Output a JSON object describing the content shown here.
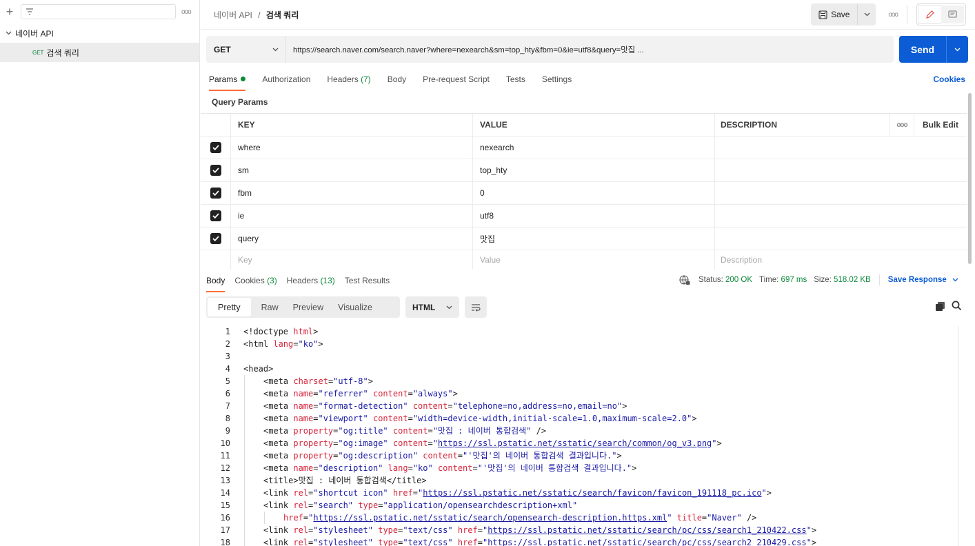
{
  "sidebar": {
    "collection": "네이버 API",
    "request": {
      "method": "GET",
      "name": "검색 쿼리"
    }
  },
  "header": {
    "breadcrumb_parent": "네이버 API",
    "breadcrumb_sep": "/",
    "breadcrumb_current": "검색 쿼리",
    "save_label": "Save"
  },
  "request": {
    "method": "GET",
    "url": "https://search.naver.com/search.naver?where=nexearch&sm=top_hty&fbm=0&ie=utf8&query=맛집 ...",
    "send_label": "Send"
  },
  "req_tabs": [
    {
      "label": "Params"
    },
    {
      "label": "Authorization"
    },
    {
      "label": "Headers",
      "count": "(7)"
    },
    {
      "label": "Body"
    },
    {
      "label": "Pre-request Script"
    },
    {
      "label": "Tests"
    },
    {
      "label": "Settings"
    }
  ],
  "cookies_link": "Cookies",
  "query_params_title": "Query Params",
  "table": {
    "headers": {
      "key": "KEY",
      "value": "VALUE",
      "description": "DESCRIPTION",
      "bulk_edit": "Bulk Edit"
    },
    "rows": [
      {
        "key": "where",
        "value": "nexearch"
      },
      {
        "key": "sm",
        "value": "top_hty"
      },
      {
        "key": "fbm",
        "value": "0"
      },
      {
        "key": "ie",
        "value": "utf8"
      },
      {
        "key": "query",
        "value": "맛집"
      }
    ],
    "placeholders": {
      "key": "Key",
      "value": "Value",
      "description": "Description"
    }
  },
  "resp_tabs": [
    {
      "label": "Body"
    },
    {
      "label": "Cookies",
      "count": "(3)"
    },
    {
      "label": "Headers",
      "count": "(13)"
    },
    {
      "label": "Test Results"
    }
  ],
  "status": {
    "status_label": "Status:",
    "status_value": "200 OK",
    "time_label": "Time:",
    "time_value": "697 ms",
    "size_label": "Size:",
    "size_value": "518.02 KB",
    "save_response": "Save Response"
  },
  "view_modes": [
    "Pretty",
    "Raw",
    "Preview",
    "Visualize"
  ],
  "format": "HTML",
  "code_lines": [
    {
      "n": "1",
      "indent": 0,
      "parts": [
        [
          "tg",
          "<!doctype "
        ],
        [
          "at",
          "html"
        ],
        [
          "tg",
          ">"
        ]
      ]
    },
    {
      "n": "2",
      "indent": 0,
      "parts": [
        [
          "tg",
          "<html "
        ],
        [
          "at",
          "lang"
        ],
        [
          "tg",
          "="
        ],
        [
          "st",
          "\"ko\""
        ],
        [
          "tg",
          ">"
        ]
      ]
    },
    {
      "n": "3",
      "indent": 0,
      "parts": []
    },
    {
      "n": "4",
      "indent": 0,
      "parts": [
        [
          "tg",
          "<head>"
        ]
      ]
    },
    {
      "n": "5",
      "indent": 1,
      "parts": [
        [
          "tg",
          "<meta "
        ],
        [
          "at",
          "charset"
        ],
        [
          "tg",
          "="
        ],
        [
          "st",
          "\"utf-8\""
        ],
        [
          "tg",
          ">"
        ]
      ]
    },
    {
      "n": "6",
      "indent": 1,
      "parts": [
        [
          "tg",
          "<meta "
        ],
        [
          "at",
          "name"
        ],
        [
          "tg",
          "="
        ],
        [
          "st",
          "\"referrer\""
        ],
        [
          "tg",
          " "
        ],
        [
          "at",
          "content"
        ],
        [
          "tg",
          "="
        ],
        [
          "st",
          "\"always\""
        ],
        [
          "tg",
          ">"
        ]
      ]
    },
    {
      "n": "7",
      "indent": 1,
      "parts": [
        [
          "tg",
          "<meta "
        ],
        [
          "at",
          "name"
        ],
        [
          "tg",
          "="
        ],
        [
          "st",
          "\"format-detection\""
        ],
        [
          "tg",
          " "
        ],
        [
          "at",
          "content"
        ],
        [
          "tg",
          "="
        ],
        [
          "st",
          "\"telephone=no,address=no,email=no\""
        ],
        [
          "tg",
          ">"
        ]
      ]
    },
    {
      "n": "8",
      "indent": 1,
      "parts": [
        [
          "tg",
          "<meta "
        ],
        [
          "at",
          "name"
        ],
        [
          "tg",
          "="
        ],
        [
          "st",
          "\"viewport\""
        ],
        [
          "tg",
          " "
        ],
        [
          "at",
          "content"
        ],
        [
          "tg",
          "="
        ],
        [
          "st",
          "\"width=device-width,initial-scale=1.0,maximum-scale=2.0\""
        ],
        [
          "tg",
          ">"
        ]
      ]
    },
    {
      "n": "9",
      "indent": 1,
      "parts": [
        [
          "tg",
          "<meta "
        ],
        [
          "at",
          "property"
        ],
        [
          "tg",
          "="
        ],
        [
          "st",
          "\"og:title\""
        ],
        [
          "tg",
          " "
        ],
        [
          "at",
          "content"
        ],
        [
          "tg",
          "="
        ],
        [
          "st",
          "\"맛집 : 네이버 통합검색\""
        ],
        [
          "tg",
          " />"
        ]
      ]
    },
    {
      "n": "10",
      "indent": 1,
      "parts": [
        [
          "tg",
          "<meta "
        ],
        [
          "at",
          "property"
        ],
        [
          "tg",
          "="
        ],
        [
          "st",
          "\"og:image\""
        ],
        [
          "tg",
          " "
        ],
        [
          "at",
          "content"
        ],
        [
          "tg",
          "="
        ],
        [
          "st",
          "\""
        ],
        [
          "lk",
          "https://ssl.pstatic.net/sstatic/search/common/og_v3.png"
        ],
        [
          "st",
          "\""
        ],
        [
          "tg",
          ">"
        ]
      ]
    },
    {
      "n": "11",
      "indent": 1,
      "parts": [
        [
          "tg",
          "<meta "
        ],
        [
          "at",
          "property"
        ],
        [
          "tg",
          "="
        ],
        [
          "st",
          "\"og:description\""
        ],
        [
          "tg",
          " "
        ],
        [
          "at",
          "content"
        ],
        [
          "tg",
          "="
        ],
        [
          "st",
          "\"'맛집'의 네이버 통합검색 결과입니다.\""
        ],
        [
          "tg",
          ">"
        ]
      ]
    },
    {
      "n": "12",
      "indent": 1,
      "parts": [
        [
          "tg",
          "<meta "
        ],
        [
          "at",
          "name"
        ],
        [
          "tg",
          "="
        ],
        [
          "st",
          "\"description\""
        ],
        [
          "tg",
          " "
        ],
        [
          "at",
          "lang"
        ],
        [
          "tg",
          "="
        ],
        [
          "st",
          "\"ko\""
        ],
        [
          "tg",
          " "
        ],
        [
          "at",
          "content"
        ],
        [
          "tg",
          "="
        ],
        [
          "st",
          "\"'맛집'의 네이버 통합검색 결과입니다.\""
        ],
        [
          "tg",
          ">"
        ]
      ]
    },
    {
      "n": "13",
      "indent": 1,
      "parts": [
        [
          "tg",
          "<title>맛집 : 네이버 통합검색</title>"
        ]
      ]
    },
    {
      "n": "14",
      "indent": 1,
      "parts": [
        [
          "tg",
          "<link "
        ],
        [
          "at",
          "rel"
        ],
        [
          "tg",
          "="
        ],
        [
          "st",
          "\"shortcut icon\""
        ],
        [
          "tg",
          " "
        ],
        [
          "at",
          "href"
        ],
        [
          "tg",
          "="
        ],
        [
          "st",
          "\""
        ],
        [
          "lk",
          "https://ssl.pstatic.net/sstatic/search/favicon/favicon_191118_pc.ico"
        ],
        [
          "st",
          "\""
        ],
        [
          "tg",
          ">"
        ]
      ]
    },
    {
      "n": "15",
      "indent": 1,
      "parts": [
        [
          "tg",
          "<link "
        ],
        [
          "at",
          "rel"
        ],
        [
          "tg",
          "="
        ],
        [
          "st",
          "\"search\""
        ],
        [
          "tg",
          " "
        ],
        [
          "at",
          "type"
        ],
        [
          "tg",
          "="
        ],
        [
          "st",
          "\"application/opensearchdescription+xml\""
        ]
      ]
    },
    {
      "n": "16",
      "indent": 2,
      "parts": [
        [
          "at",
          "href"
        ],
        [
          "tg",
          "="
        ],
        [
          "st",
          "\""
        ],
        [
          "lk",
          "https://ssl.pstatic.net/sstatic/search/opensearch-description.https.xml"
        ],
        [
          "st",
          "\""
        ],
        [
          "tg",
          " "
        ],
        [
          "at",
          "title"
        ],
        [
          "tg",
          "="
        ],
        [
          "st",
          "\"Naver\""
        ],
        [
          "tg",
          " />"
        ]
      ]
    },
    {
      "n": "17",
      "indent": 1,
      "parts": [
        [
          "tg",
          "<link "
        ],
        [
          "at",
          "rel"
        ],
        [
          "tg",
          "="
        ],
        [
          "st",
          "\"stylesheet\""
        ],
        [
          "tg",
          " "
        ],
        [
          "at",
          "type"
        ],
        [
          "tg",
          "="
        ],
        [
          "st",
          "\"text/css\""
        ],
        [
          "tg",
          " "
        ],
        [
          "at",
          "href"
        ],
        [
          "tg",
          "="
        ],
        [
          "st",
          "\""
        ],
        [
          "lk",
          "https://ssl.pstatic.net/sstatic/search/pc/css/search1_210422.css"
        ],
        [
          "st",
          "\""
        ],
        [
          "tg",
          ">"
        ]
      ]
    },
    {
      "n": "18",
      "indent": 1,
      "parts": [
        [
          "tg",
          "<link "
        ],
        [
          "at",
          "rel"
        ],
        [
          "tg",
          "="
        ],
        [
          "st",
          "\"stylesheet\""
        ],
        [
          "tg",
          " "
        ],
        [
          "at",
          "type"
        ],
        [
          "tg",
          "="
        ],
        [
          "st",
          "\"text/css\""
        ],
        [
          "tg",
          " "
        ],
        [
          "at",
          "href"
        ],
        [
          "tg",
          "="
        ],
        [
          "st",
          "\""
        ],
        [
          "lk",
          "https://ssl.pstatic.net/sstatic/search/pc/css/search2_210429.css"
        ],
        [
          "st",
          "\""
        ],
        [
          "tg",
          ">"
        ]
      ]
    }
  ]
}
